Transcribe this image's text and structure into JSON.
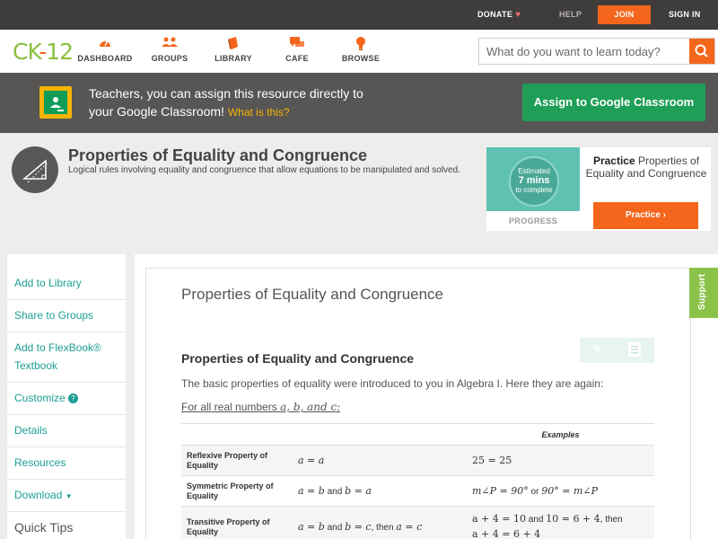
{
  "topbar": {
    "donate": "DONATE",
    "help": "HELP",
    "join": "JOIN",
    "signin": "SIGN IN"
  },
  "logo": {
    "left": "CK",
    "dash": "-",
    "right": "12"
  },
  "nav": [
    {
      "label": "DASHBOARD",
      "icon": "speedometer-icon"
    },
    {
      "label": "GROUPS",
      "icon": "people-icon"
    },
    {
      "label": "LIBRARY",
      "icon": "book-icon"
    },
    {
      "label": "CAFE",
      "icon": "chat-icon"
    },
    {
      "label": "BROWSE",
      "icon": "lightbulb-icon"
    }
  ],
  "search": {
    "placeholder": "What do you want to learn today?"
  },
  "banner": {
    "line1": "Teachers, you can assign this resource directly to",
    "line2": "your Google Classroom!",
    "what": "What is this?",
    "assign": "Assign to Google Classroom"
  },
  "concept": {
    "title": "Properties of Equality and Congruence",
    "desc": "Logical rules involving equality and congruence that allow equations to be manipulated and solved."
  },
  "practice": {
    "estimated": "Estimated",
    "mins": "7 mins",
    "complete": "to complete",
    "progress": "PROGRESS",
    "heading_bold": "Practice",
    "heading_rest": "Properties of Equality and Congruence",
    "button": "Practice"
  },
  "sidebar": {
    "items": [
      "Add to Library",
      "Share to Groups",
      "Add to FlexBook®",
      "Textbook",
      "Customize",
      "Details",
      "Resources",
      "Download"
    ],
    "quick_tips": "Quick Tips"
  },
  "content": {
    "title": "Properties of Equality and Congruence",
    "section_title": "Properties of Equality and Congruence",
    "intro": "The basic properties of equality were introduced to you in Algebra I. Here they are again:",
    "forall_text": "For all real numbers",
    "forall_vars": "a, b, and c:",
    "table": {
      "header": "Examples",
      "rows": [
        {
          "name": "Reflexive Property of Equality",
          "sym": "a = a",
          "ex": "25 = 25"
        },
        {
          "name": "Symmetric Property of Equality",
          "sym_a": "a = b",
          "and": "and",
          "sym_b": "b = a",
          "ex_a": "m∠P = 90°",
          "or": "or",
          "ex_b": "90° = m∠P"
        },
        {
          "name": "Transitive Property of Equality",
          "sym_a": "a = b",
          "and": "and",
          "sym_b": "b = c",
          "then": ", then",
          "sym_c": "a = c",
          "ex_a": "a + 4 = 10",
          "and2": "and",
          "ex_b": "10 = 6 + 4",
          "then2": ", then",
          "ex_c": "a + 4 = 6 + 4"
        }
      ]
    }
  },
  "support": "Support",
  "colors": {
    "accent": "#f4661b",
    "teal": "#1c9e94",
    "green": "#1e9e57"
  }
}
